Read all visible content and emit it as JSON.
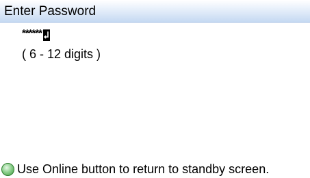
{
  "header": {
    "title": "Enter Password"
  },
  "password": {
    "masked_value": "******",
    "cursor_icon": "enter-return-icon"
  },
  "hint": {
    "text": "( 6 - 12 digits )"
  },
  "footer": {
    "icon": "online-led-icon",
    "icon_color": "#6cc46c",
    "message": "Use Online button to return to standby screen."
  },
  "colors": {
    "header_gradient_top": "#ffffff",
    "header_gradient_bottom": "#c5d9f2",
    "background": "#ffffff"
  }
}
